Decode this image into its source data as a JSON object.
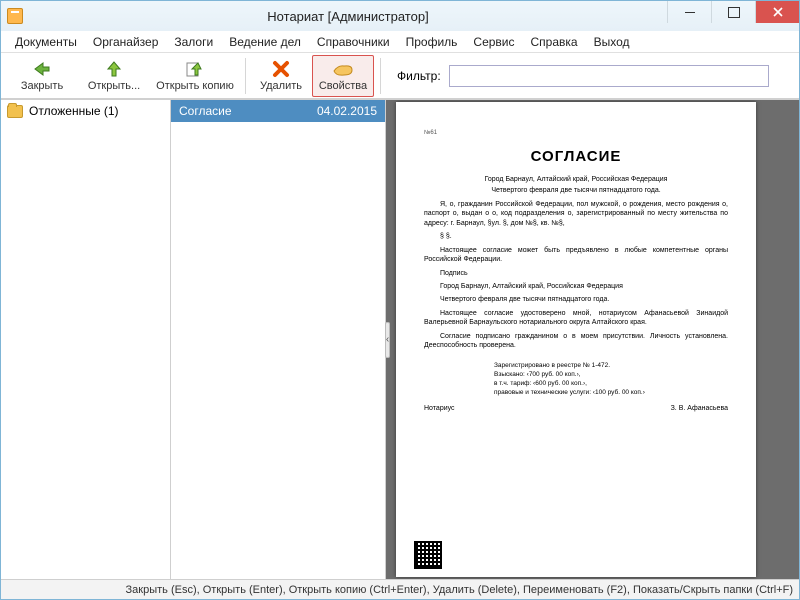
{
  "window": {
    "title": "Нотариат [Администратор]"
  },
  "menu": {
    "items": [
      "Документы",
      "Органайзер",
      "Залоги",
      "Ведение дел",
      "Справочники",
      "Профиль",
      "Сервис",
      "Справка",
      "Выход"
    ]
  },
  "toolbar": {
    "close": "Закрыть",
    "open": "Открыть...",
    "open_copy": "Открыть копию",
    "delete": "Удалить",
    "properties": "Свойства",
    "filter_label": "Фильтр:",
    "filter_value": ""
  },
  "folders": {
    "items": [
      {
        "label": "Отложенные (1)"
      }
    ]
  },
  "doclist": {
    "items": [
      {
        "title": "Согласие",
        "date": "04.02.2015"
      }
    ]
  },
  "preview": {
    "header_num": "№61",
    "title": "СОГЛАСИЕ",
    "line1": "Город Барнаул, Алтайский край, Российская Федерация",
    "line2": "Четвертого февраля две тысячи пятнадцатого года.",
    "para1": "Я, о, гражданин Российской Федерации, пол мужской, о рождения, место рождения о, паспорт о, выдан о о, код подразделения о, зарегистрированный по месту жительства по адресу: г. Барнаул, §ул. §, дом №§, кв. №§,",
    "para1b": "§ §.",
    "para2": "Настоящее согласие может быть предъявлено в любые компетентные органы Российской Федерации.",
    "para3": "Подпись",
    "line3": "Город Барнаул, Алтайский край, Российская Федерация",
    "line4": "Четвертого февраля две тысячи пятнадцатого года.",
    "para4": "Настоящее согласие удостоверено мной, нотариусом Афанасьевой Зинаидой Валерьевной Барнаульского нотариального округа Алтайского края.",
    "para5": "Согласие подписано гражданином о в моем присутствии. Личность установлена. Дееспособность проверена.",
    "reg1": "Зарегистрировано в реестре № 1-472.",
    "reg2": "Взыскано: ‹700 руб. 00 коп.›,",
    "reg3": "в т.ч. тариф: ‹600 руб. 00 коп.›,",
    "reg4": "правовые и технические услуги: ‹100 руб. 00 коп.›",
    "notary_label": "Нотариус",
    "notary_name": "З. В. Афанасьева"
  },
  "statusbar": "Закрыть (Esc),  Открыть (Enter),  Открыть копию (Ctrl+Enter),  Удалить (Delete),  Переименовать (F2),  Показать/Скрыть папки (Ctrl+F)"
}
